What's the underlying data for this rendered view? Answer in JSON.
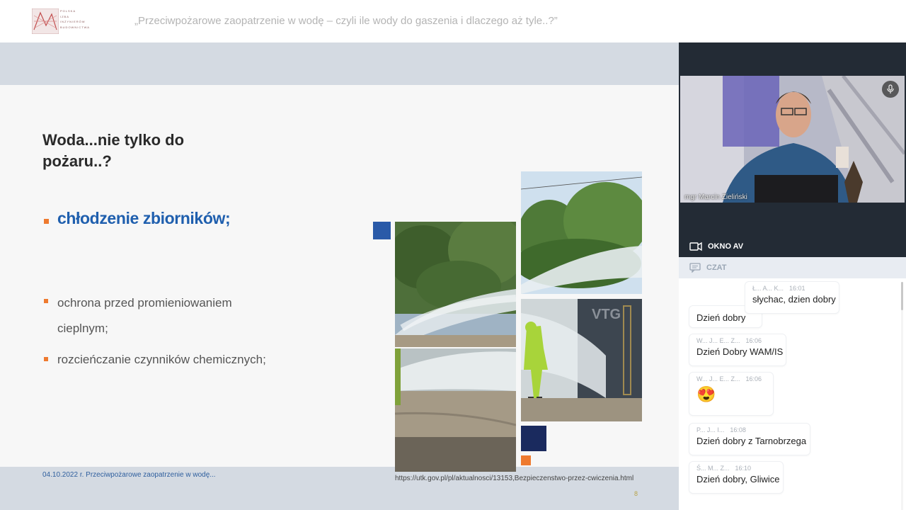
{
  "header": {
    "title": "„Przeciwpożarowe zaopatrzenie w wodę – czyli ile wody do gaszenia i dlaczego aż tyle..?”",
    "logo_lines": [
      "POLSKA",
      "IZBA",
      "INŻYNIERÓW",
      "BUDOWNICTWA"
    ]
  },
  "slide": {
    "title": "Woda...nie tylko do pożaru..?",
    "bullets": [
      "chłodzenie zbiorników;",
      "ochrona przed promieniowaniem cieplnym;",
      "rozcieńczanie czynników chemicznych;"
    ],
    "footer": "04.10.2022 r.  Przeciwpożarowe zaopatrzenie w wodę...",
    "source": "https://utk.gov.pl/pl/aktualnosci/13153,Bezpieczenstwo-przez-cwiczenia.html",
    "page": "8"
  },
  "video": {
    "presenter": "mgr Marcin Zieliński",
    "av_label": "OKNO AV"
  },
  "chat": {
    "tab_label": "CZAT",
    "partial_message": "Dzień dobry",
    "messages": [
      {
        "author": "Ł... A... K...",
        "time": "16:01",
        "text": "słychac, dzien dobry"
      },
      {
        "author": "W... J... E... Z...",
        "time": "16:06",
        "text": "Dzień Dobry WAM/IS"
      },
      {
        "author": "W... J... E... Z...",
        "time": "16:06",
        "text": "😍"
      },
      {
        "author": "P... J... I...",
        "time": "16:08",
        "text": "Dzień dobry z Tarnobrzega"
      },
      {
        "author": "Ś... M... Z...",
        "time": "16:10",
        "text": "Dzień dobry, Gliwice"
      }
    ]
  },
  "colors": {
    "accent_blue": "#1f5fae",
    "bullet_orange": "#ee7a2f",
    "panel_dark": "#232b35"
  }
}
